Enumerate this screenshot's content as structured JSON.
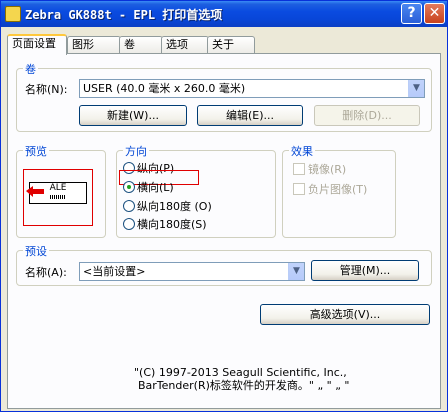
{
  "window": {
    "title": "Zebra GK888t - EPL 打印首选项",
    "help_label": "?",
    "close_label": "✕"
  },
  "tabs": [
    {
      "label": "页面设置",
      "active": true
    },
    {
      "label": "图形",
      "active": false
    },
    {
      "label": "卷",
      "active": false
    },
    {
      "label": "选项",
      "active": false
    },
    {
      "label": "关于",
      "active": false
    }
  ],
  "stock": {
    "group_label": "卷",
    "name_label": "名称(N):",
    "name_value": "USER (40.0 毫米 x 260.0 毫米)",
    "new_button": "新建(W)...",
    "edit_button": "编辑(E)...",
    "delete_button": "删除(D)..."
  },
  "preview": {
    "group_label": "预览",
    "label_text": "ALE"
  },
  "orientation": {
    "group_label": "方向",
    "options": [
      {
        "label": "纵向(P)",
        "selected": false
      },
      {
        "label": "横向(L)",
        "selected": true
      },
      {
        "label": "纵向180度 (O)",
        "selected": false
      },
      {
        "label": "横向180度(S)",
        "selected": false
      }
    ]
  },
  "effects": {
    "group_label": "效果",
    "options": [
      {
        "label": "镜像(R)",
        "checked": false,
        "enabled": false
      },
      {
        "label": "负片图像(T)",
        "checked": false,
        "enabled": false
      }
    ]
  },
  "presets": {
    "group_label": "预设",
    "name_label": "名称(A):",
    "name_value": "<当前设置>",
    "manage_button": "管理(M)..."
  },
  "advanced_button": "高级选项(V)...",
  "footer": {
    "line1": "\"(C) 1997-2013 Seagull Scientific, Inc.,",
    "line2": "BarTender(R)标签软件的开发商。\"   „ \"   „ \""
  },
  "colors": {
    "title_bar": "#0a4be0",
    "group_label": "#0046d5",
    "highlight": "#e00000",
    "tab_accent": "#ffc83c"
  }
}
